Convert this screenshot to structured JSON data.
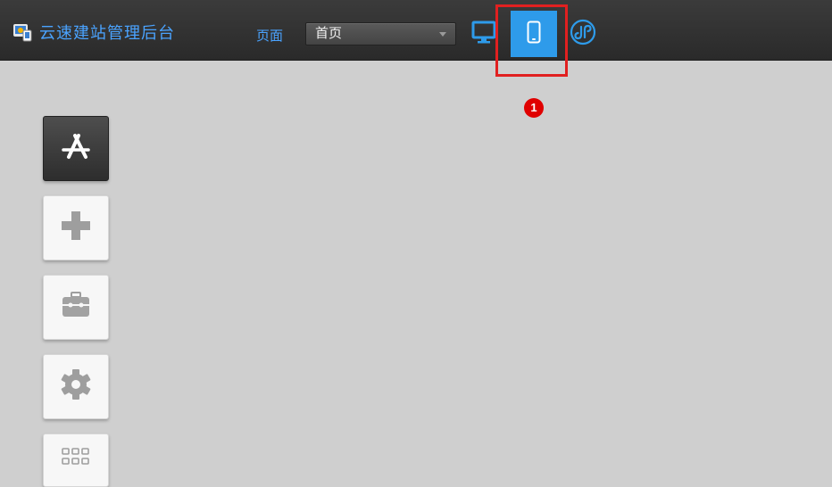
{
  "header": {
    "app_title": "云速建站管理后台",
    "page_label": "页面",
    "page_select_value": "首页"
  },
  "view_modes": {
    "desktop_icon": "monitor-icon",
    "mobile_icon": "mobile-phone-icon",
    "mini_program_icon": "mini-program-icon",
    "active": "mobile"
  },
  "annotation": {
    "step_number": "1"
  },
  "dock": {
    "items": [
      "app-store-icon",
      "plus-icon",
      "toolbox-icon",
      "gear-icon",
      "grid-icon"
    ]
  },
  "colors": {
    "accent": "#2e9bea",
    "title_blue": "#4aa3ff",
    "highlight_red": "#e12020",
    "canvas": "#cfcfcf",
    "topbar": "#2f2f2f"
  }
}
